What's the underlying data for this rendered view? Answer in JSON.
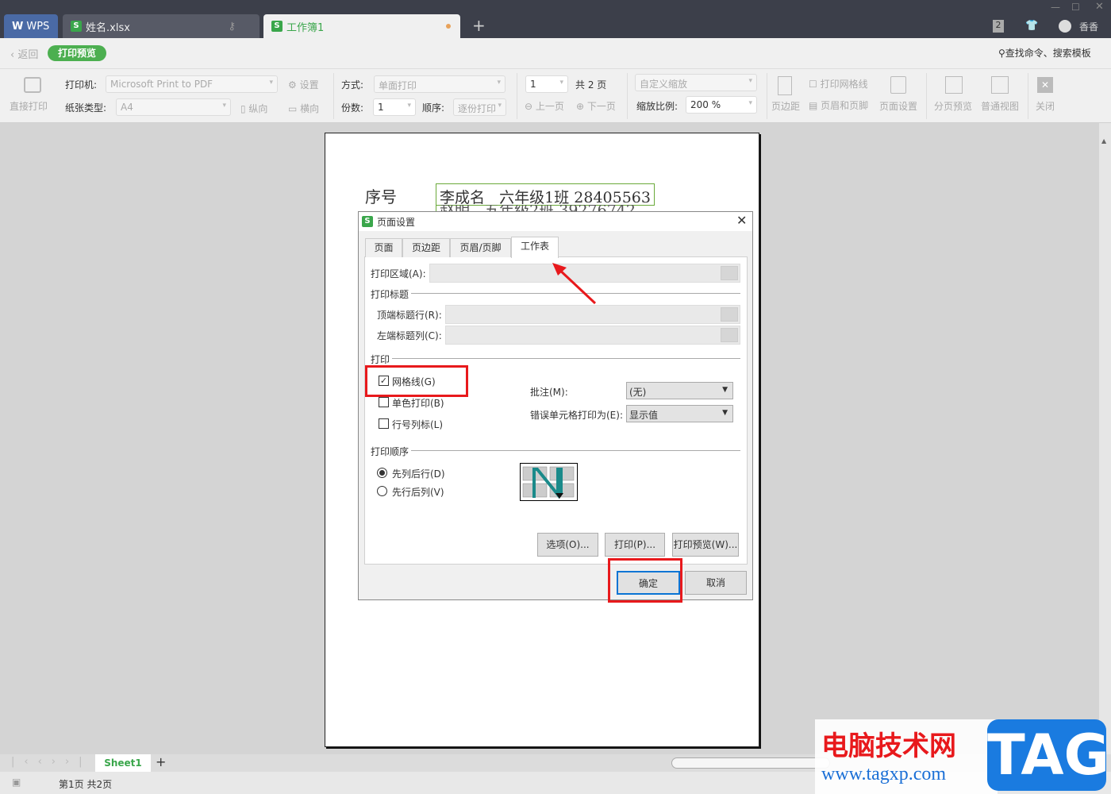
{
  "titlebar": {
    "tabs": [
      {
        "label": "WPS"
      },
      {
        "label": "姓名.xlsx"
      },
      {
        "label": "工作簿1"
      }
    ],
    "new_tab": "+",
    "badge": "2",
    "user": "香香"
  },
  "nav": {
    "back": "返回",
    "mode": "打印预览",
    "search": "查找命令、搜索模板"
  },
  "ribbon": {
    "direct_print": "直接打印",
    "printer_label": "打印机:",
    "printer": "Microsoft Print to PDF",
    "settings": "设置",
    "paper_label": "纸张类型:",
    "paper": "A4",
    "portrait": "纵向",
    "landscape": "横向",
    "method_label": "方式:",
    "method": "单面打印",
    "copies_label": "份数:",
    "copies": "1",
    "order_label": "顺序:",
    "order": "逐份打印",
    "page": "1",
    "total": "共 2 页",
    "prev": "上一页",
    "next": "下一页",
    "zoom_mode": "自定义缩放",
    "zoom_label": "缩放比例:",
    "zoom": "200 %",
    "margins": "页边距",
    "print_gridlines": "打印网格线",
    "header_footer": "页眉和页脚",
    "page_setup": "页面设置",
    "page_break": "分页预览",
    "normal_view": "普通视图",
    "close": "关闭"
  },
  "sheet": {
    "header": "序号",
    "row1": "李成名",
    "row1b": "六年级1班 28405563",
    "row2": "赵明",
    "row2b": "五年级2班 39276742"
  },
  "dialog": {
    "title": "页面设置",
    "tabs": [
      "页面",
      "页边距",
      "页眉/页脚",
      "工作表"
    ],
    "print_area": "打印区域(A):",
    "print_titles": "打印标题",
    "top_rows": "顶端标题行(R):",
    "left_cols": "左端标题列(C):",
    "print_section": "打印",
    "gridlines": "网格线(G)",
    "gridlines_checked": true,
    "mono": "单色打印(B)",
    "rowcol": "行号列标(L)",
    "comments_label": "批注(M):",
    "comments": "(无)",
    "errors_label": "错误单元格打印为(E):",
    "errors": "显示值",
    "order_section": "打印顺序",
    "down_then_over": "先列后行(D)",
    "over_then_down": "先行后列(V)",
    "options": "选项(O)...",
    "print": "打印(P)...",
    "preview": "打印预览(W)...",
    "ok": "确定",
    "cancel": "取消"
  },
  "sheetbar": {
    "sheet": "Sheet1",
    "add": "+"
  },
  "status": {
    "pages": "第1页 共2页"
  },
  "watermark": {
    "site_cn": "电脑技术网",
    "url": "www.tagxp.com",
    "logo": "TAG"
  },
  "colors": {
    "accent": "#3aa64b",
    "highlight": "#e8191c",
    "titlebar": "#3c3f4a"
  }
}
